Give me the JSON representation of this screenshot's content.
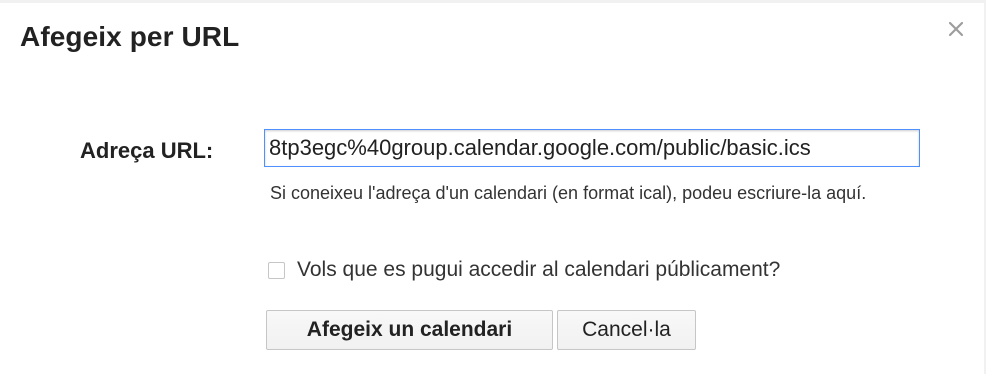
{
  "dialog": {
    "title": "Afegeix per URL",
    "close_icon": "close-icon"
  },
  "form": {
    "url_label": "Adreça URL:",
    "url_value": "8tp3egc%40group.calendar.google.com/public/basic.ics",
    "hint": "Si coneixeu l'adreça d'un calendari (en format ical), podeu escriure-la aquí.",
    "public_checkbox_label": "Vols que es pugui accedir al calendari públicament?",
    "public_checkbox_checked": false
  },
  "actions": {
    "add_label": "Afegeix un calendari",
    "cancel_label": "Cancel·la"
  },
  "colors": {
    "input_focus_border": "#4d90fe",
    "button_border": "#c6c6c6",
    "text": "#222222"
  }
}
